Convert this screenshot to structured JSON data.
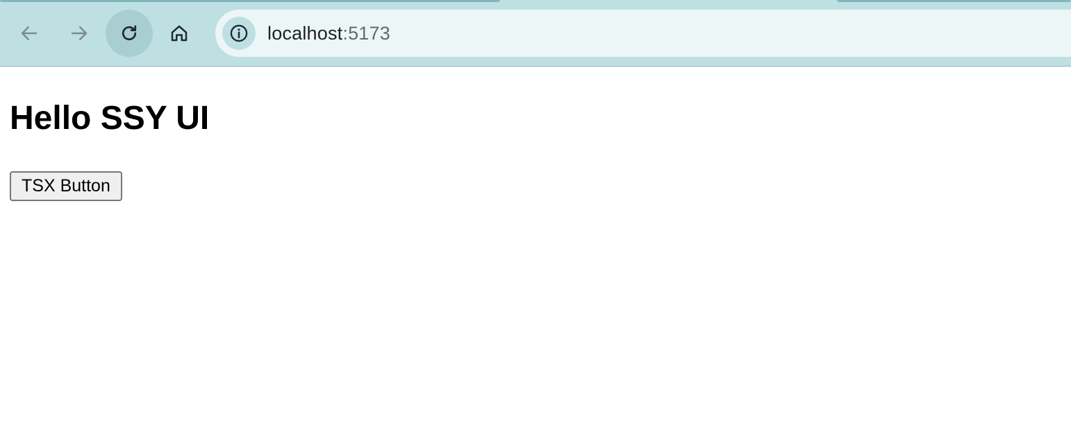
{
  "browser": {
    "address_bar": {
      "host": "localhost",
      "port": ":5173"
    },
    "icons": {
      "back": "back-arrow-icon",
      "forward": "forward-arrow-icon",
      "reload": "reload-icon",
      "home": "home-icon",
      "site_info": "info-icon"
    },
    "colors": {
      "toolbar": "#bfe0e3",
      "omnibox": "#edf6f7",
      "reload_hover": "#a9ced2"
    }
  },
  "page": {
    "title": "Hello SSY UI",
    "button_label": "TSX Button"
  }
}
